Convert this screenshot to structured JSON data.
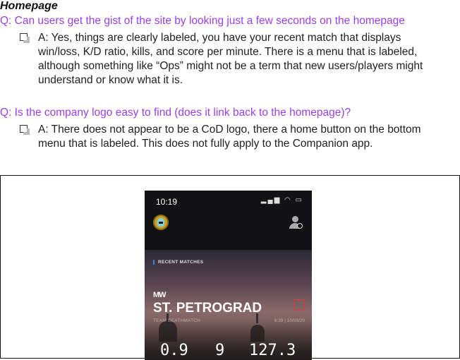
{
  "section": {
    "heading": "Homepage"
  },
  "qa": [
    {
      "question": "Q: Can users get the gist of the site by looking just a few seconds on the homepage",
      "answer_lines": [
        "A: Yes, things are clearly labeled, you have your recent match that displays",
        "win/loss,  K/D ratio, kills, and score per minute. There is a menu that is labeled,",
        "although something like “Ops” might not be a term that new users/players might",
        "understand or know what it is."
      ]
    },
    {
      "question": "Q: Is the company logo easy to find (does it link back to the homepage)?",
      "answer_lines": [
        "A: There does not appear to be a CoD logo, there a home button on the bottom",
        "menu that is labeled. This does not fully apply to the Companion app."
      ]
    }
  ],
  "phone": {
    "time": "10:19",
    "recent_label": "RECENT MATCHES",
    "game_logo": "MW",
    "map_name": "ST. PETROGRAD",
    "mode": "TEAM DEATHMATCH",
    "time_date": "6:39 | 10/03/20",
    "stats": [
      "0.9",
      "9",
      "127.3"
    ],
    "icons": {
      "status": "signal-wifi-battery-icon",
      "avatar": "avatar-icon",
      "profile": "profile-search-icon"
    },
    "accent_color": "#3b7ddd",
    "highlight_color": "#e03a3a"
  },
  "colors": {
    "question": "#9b3fe6"
  }
}
